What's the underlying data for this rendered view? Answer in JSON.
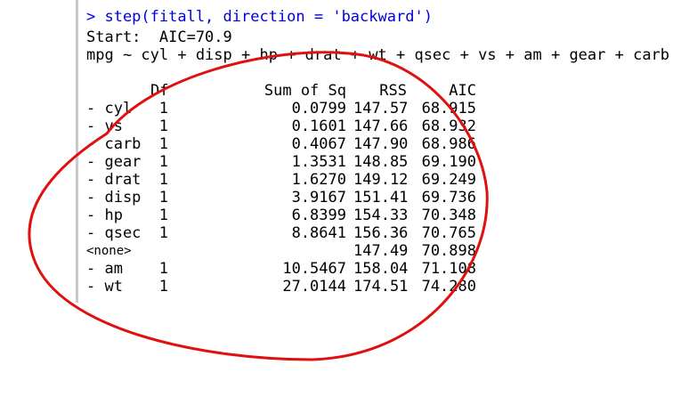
{
  "console": {
    "command": "> step(fitall, direction = 'backward')",
    "start": "Start:  AIC=70.9",
    "formula": "mpg ~ cyl + disp + hp + drat + wt + qsec + vs + am + gear + carb",
    "headers": {
      "name": "",
      "df": "Df",
      "ss": "Sum of Sq",
      "rss": "RSS",
      "aic": "AIC"
    },
    "rows": [
      {
        "name": "- cyl",
        "df": "1",
        "ss": "0.0799",
        "rss": "147.57",
        "aic": "68.915"
      },
      {
        "name": "- vs",
        "df": "1",
        "ss": "0.1601",
        "rss": "147.66",
        "aic": "68.932"
      },
      {
        "name": "- carb",
        "df": "1",
        "ss": "0.4067",
        "rss": "147.90",
        "aic": "68.986"
      },
      {
        "name": "- gear",
        "df": "1",
        "ss": "1.3531",
        "rss": "148.85",
        "aic": "69.190"
      },
      {
        "name": "- drat",
        "df": "1",
        "ss": "1.6270",
        "rss": "149.12",
        "aic": "69.249"
      },
      {
        "name": "- disp",
        "df": "1",
        "ss": "3.9167",
        "rss": "151.41",
        "aic": "69.736"
      },
      {
        "name": "- hp",
        "df": "1",
        "ss": "6.8399",
        "rss": "154.33",
        "aic": "70.348"
      },
      {
        "name": "- qsec",
        "df": "1",
        "ss": "8.8641",
        "rss": "156.36",
        "aic": "70.765"
      },
      {
        "name": "<none>",
        "df": "",
        "ss": "",
        "rss": "147.49",
        "aic": "70.898"
      },
      {
        "name": "- am",
        "df": "1",
        "ss": "10.5467",
        "rss": "158.04",
        "aic": "71.108"
      },
      {
        "name": "- wt",
        "df": "1",
        "ss": "27.0144",
        "rss": "174.51",
        "aic": "74.280"
      }
    ]
  },
  "colors": {
    "command": "#0000dd",
    "output": "#000000",
    "annotation": "#e01010",
    "gutter": "#c9c9c9"
  }
}
